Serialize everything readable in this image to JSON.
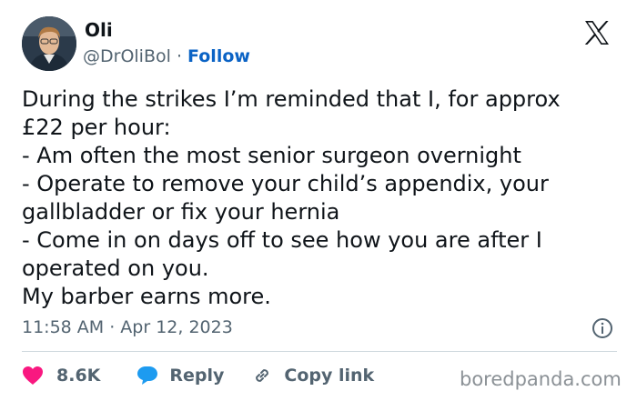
{
  "author": {
    "name": "Oli",
    "handle": "@DrOliBol",
    "separator": "·",
    "follow_label": "Follow"
  },
  "tweet": {
    "text": "During the strikes I’m reminded that I, for approx\n£22 per hour:\n- Am often the most senior surgeon overnight\n- Operate to remove your child’s appendix, your\ngallbladder or fix your hernia\n- Come in on days off to see how you are after I\noperated on you.\nMy barber earns more.",
    "timestamp": "11:58 AM · Apr 12, 2023"
  },
  "actions": {
    "likes": "8.6K",
    "reply_label": "Reply",
    "copy_link_label": "Copy link"
  },
  "watermark": "boredpanda.com",
  "icons": {
    "platform": "x-logo-icon",
    "like": "heart-icon",
    "reply": "speech-bubble-icon",
    "copy": "link-icon",
    "info": "info-icon"
  },
  "colors": {
    "heart": "#f91880",
    "reply_bubble": "#1d9bf0",
    "follow_link": "#0b63c5",
    "secondary_text": "#536471"
  }
}
